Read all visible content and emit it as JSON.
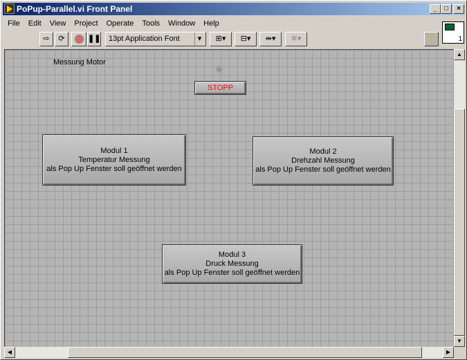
{
  "window": {
    "title": "PoPup-Parallel.vi Front Panel"
  },
  "menu": [
    {
      "label": "File"
    },
    {
      "label": "Edit"
    },
    {
      "label": "View"
    },
    {
      "label": "Project"
    },
    {
      "label": "Operate"
    },
    {
      "label": "Tools"
    },
    {
      "label": "Window"
    },
    {
      "label": "Help"
    }
  ],
  "toolbar": {
    "font": "13pt Application Font",
    "help": "?",
    "icon_number": "1"
  },
  "panel": {
    "label": "Messung Motor",
    "stop": "STOPP",
    "modules": [
      {
        "l1": "Modul 1",
        "l2": "Temperatur Messung",
        "l3": "als Pop Up Fenster soll geöffnet werden"
      },
      {
        "l1": "Modul 2",
        "l2": "Drehzahl Messung",
        "l3": "als Pop Up Fenster soll geöffnet werden"
      },
      {
        "l1": "Modul 3",
        "l2": "Druck Messung",
        "l3": "als Pop Up Fenster soll geöffnet werden"
      }
    ]
  },
  "colors": {
    "stop_text": "#ff0000",
    "panel_bg": "#b4b4b4"
  }
}
